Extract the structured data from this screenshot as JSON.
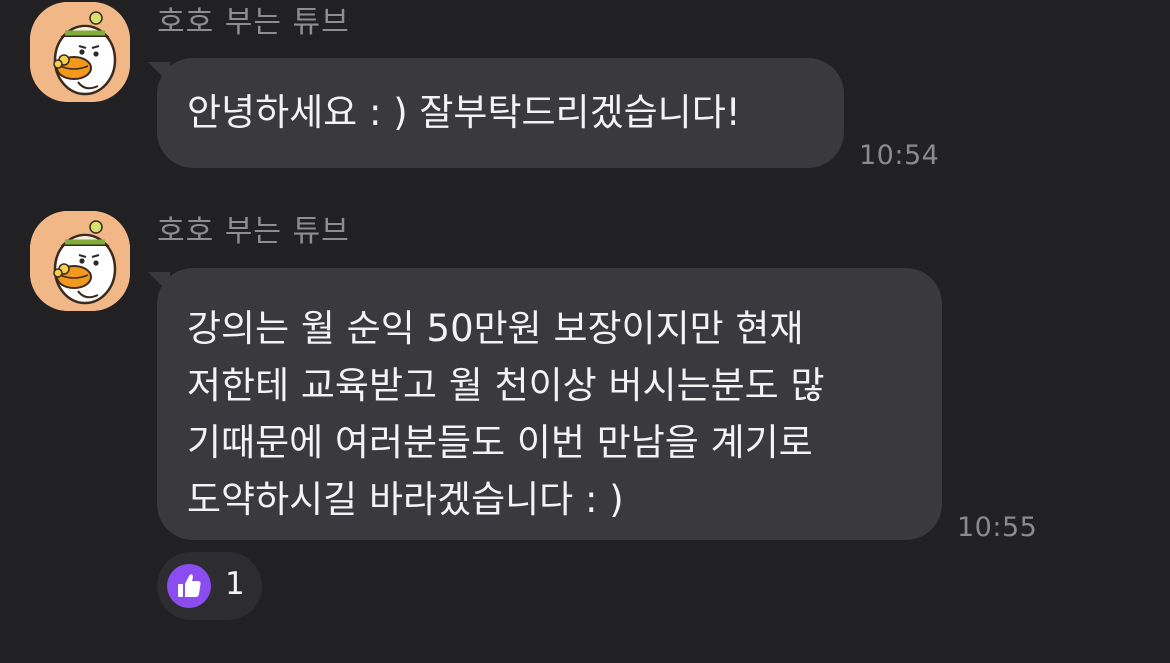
{
  "messages": [
    {
      "sender": "호호 부는 튜브",
      "avatar_icon": "tube-character-avatar-icon",
      "text": "안녕하세요 : ) 잘부탁드리겠습니다!",
      "time": "10:54"
    },
    {
      "sender": "호호 부는 튜브",
      "avatar_icon": "tube-character-avatar-icon",
      "text": "강의는 월 순익 50만원 보장이지만 현재\n저한테 교육받고 월 천이상 버시는분도 많\n기때문에 여러분들도 이번 만남을 계기로\n도약하시길 바라겠습니다 : )",
      "time": "10:55",
      "reaction": {
        "icon": "thumbs-up-icon",
        "count": "1"
      }
    }
  ],
  "colors": {
    "background": "#212124",
    "bubble": "#3a3a3e",
    "sender_text": "#8d8d92",
    "message_text": "#f3f3f3",
    "avatar_bg": "#f2b787",
    "reaction_accent": "#8b4cf0"
  }
}
